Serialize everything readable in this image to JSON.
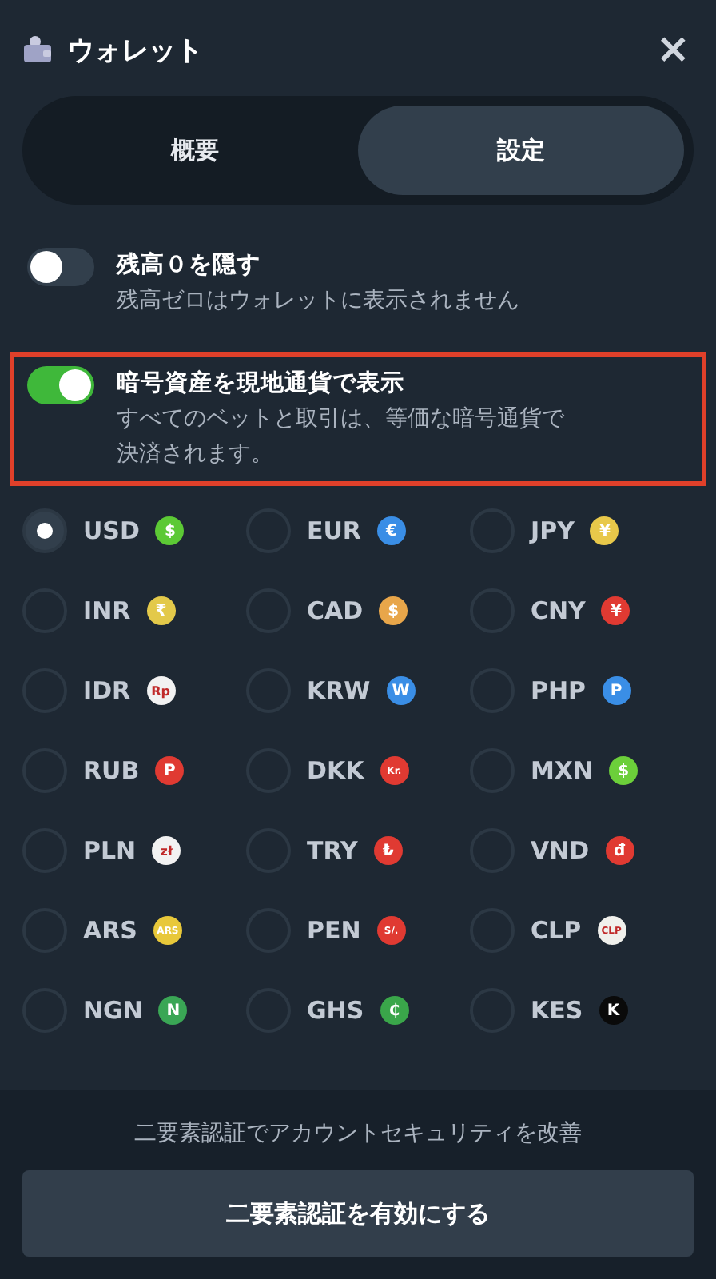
{
  "header": {
    "title": "ウォレット",
    "close": "×"
  },
  "tabs": [
    {
      "label": "概要",
      "selected": false
    },
    {
      "label": "設定",
      "selected": true
    }
  ],
  "settings": [
    {
      "title": "残高０を隠す",
      "description": "残高ゼロはウォレットに表示されません",
      "on": false,
      "highlighted": false
    },
    {
      "title": "暗号資産を現地通貨で表示",
      "description": "すべてのベットと取引は、等価な暗号通貨で決済されます。",
      "on": true,
      "highlighted": true
    }
  ],
  "currencies": [
    {
      "code": "USD",
      "symbol": "$",
      "color": "#5cc935",
      "selected": true
    },
    {
      "code": "EUR",
      "symbol": "€",
      "color": "#3a8ee6",
      "selected": false
    },
    {
      "code": "JPY",
      "symbol": "¥",
      "color": "#e8c84a",
      "selected": false
    },
    {
      "code": "INR",
      "symbol": "₹",
      "color": "#e3c94a",
      "selected": false
    },
    {
      "code": "CAD",
      "symbol": "$",
      "color": "#e8a64a",
      "selected": false
    },
    {
      "code": "CNY",
      "symbol": "¥",
      "color": "#e03a32",
      "selected": false
    },
    {
      "code": "IDR",
      "symbol": "Rp",
      "color": "#f2f2f2",
      "selected": false
    },
    {
      "code": "KRW",
      "symbol": "W",
      "color": "#3a8ee6",
      "selected": false
    },
    {
      "code": "PHP",
      "symbol": "P",
      "color": "#3a8ee6",
      "selected": false
    },
    {
      "code": "RUB",
      "symbol": "P",
      "color": "#e03a32",
      "selected": false
    },
    {
      "code": "DKK",
      "symbol": "Kr.",
      "color": "#e03a32",
      "selected": false
    },
    {
      "code": "MXN",
      "symbol": "$",
      "color": "#6ccf3a",
      "selected": false
    },
    {
      "code": "PLN",
      "symbol": "zł",
      "color": "#f2f2f2",
      "selected": false
    },
    {
      "code": "TRY",
      "symbol": "₺",
      "color": "#e03a32",
      "selected": false
    },
    {
      "code": "VND",
      "symbol": "đ",
      "color": "#e03a32",
      "selected": false
    },
    {
      "code": "ARS",
      "symbol": "ARS",
      "color": "#e8c83a",
      "selected": false
    },
    {
      "code": "PEN",
      "symbol": "S/.",
      "color": "#e03a32",
      "selected": false
    },
    {
      "code": "CLP",
      "symbol": "CLP",
      "color": "#f0f0ec",
      "selected": false
    },
    {
      "code": "NGN",
      "symbol": "N",
      "color": "#3aa655",
      "selected": false
    },
    {
      "code": "GHS",
      "symbol": "₵",
      "color": "#3aa64a",
      "selected": false
    },
    {
      "code": "KES",
      "symbol": "K",
      "color": "#0a0a0a",
      "selected": false
    }
  ],
  "footer": {
    "message": "二要素認証でアカウントセキュリティを改善",
    "button": "二要素認証を有効にする"
  }
}
